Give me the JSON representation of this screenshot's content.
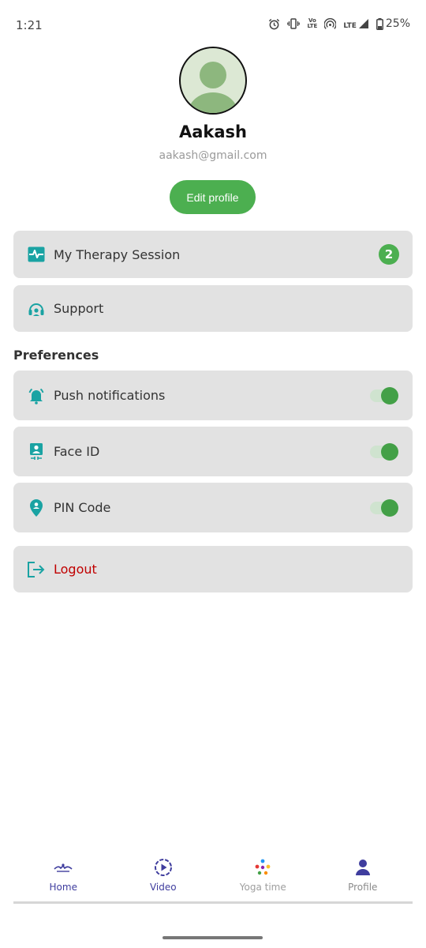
{
  "status_bar": {
    "time": "1:21",
    "network_top": "LTE",
    "volte_top": "Vo",
    "volte_bottom": "LTE",
    "battery": "25%"
  },
  "profile": {
    "name": "Aakash",
    "email": "aakash@gmail.com",
    "edit_label": "Edit profile"
  },
  "menu": {
    "therapy": {
      "label": "My Therapy Session",
      "badge": "2",
      "icon": "pulse-icon"
    },
    "support": {
      "label": "Support",
      "icon": "support-icon"
    }
  },
  "preferences": {
    "title": "Preferences",
    "items": [
      {
        "label": "Push notifications",
        "enabled": true,
        "icon": "bell-icon"
      },
      {
        "label": "Face ID",
        "enabled": true,
        "icon": "face-id-icon"
      },
      {
        "label": "PIN Code",
        "enabled": true,
        "icon": "pin-icon"
      }
    ]
  },
  "logout": {
    "label": "Logout",
    "icon": "logout-icon"
  },
  "bottom_nav": {
    "items": [
      {
        "label": "Home",
        "icon": "home-icon",
        "color": "#3f3d9e"
      },
      {
        "label": "Video",
        "icon": "video-icon",
        "color": "#3f3d9e"
      },
      {
        "label": "Yoga time",
        "icon": "yoga-icon",
        "color": "#9e9e9e"
      },
      {
        "label": "Profile",
        "icon": "profile-icon",
        "color": "#8a8a8a"
      }
    ]
  },
  "colors": {
    "accent_green": "#4caf50",
    "icon_teal": "#1aa3a3",
    "logout_red": "#c00000",
    "card_bg": "#e2e2e2"
  }
}
